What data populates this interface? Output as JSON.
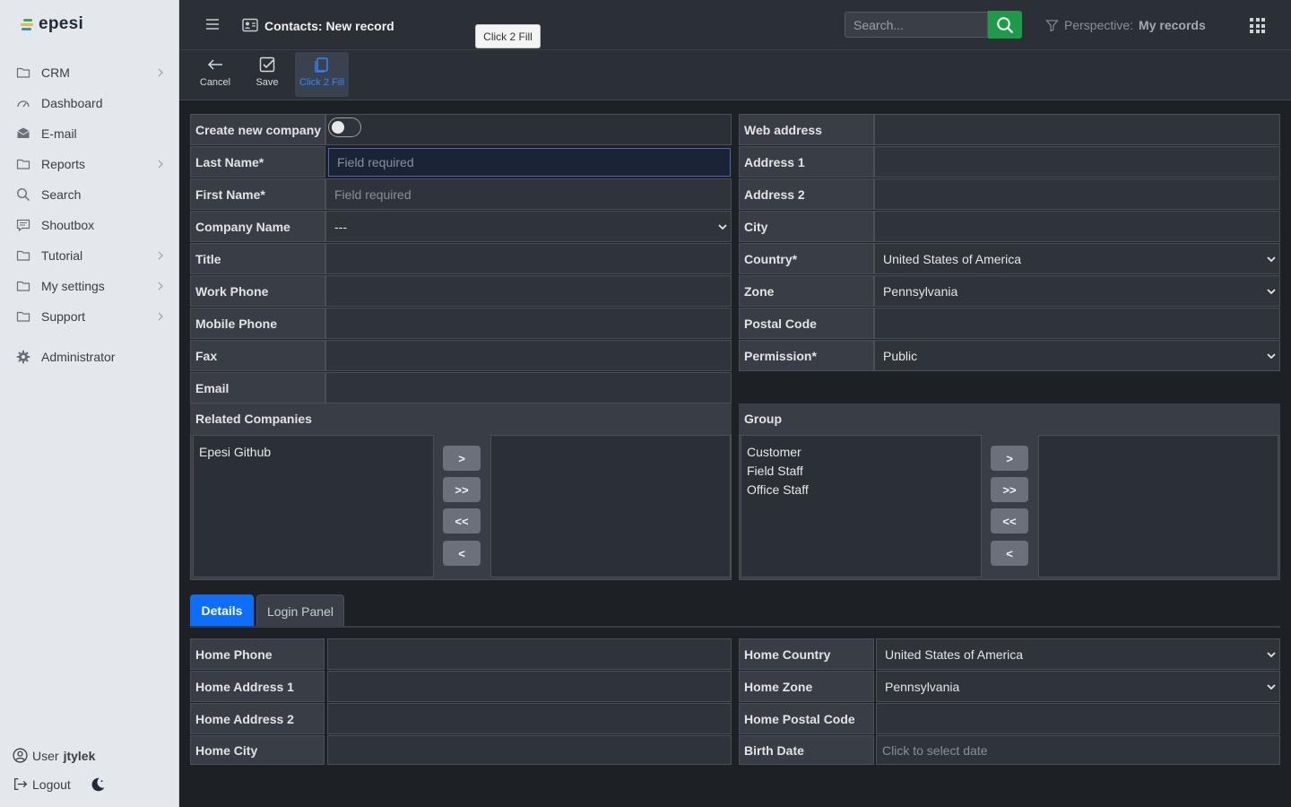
{
  "app": {
    "name": "epesi"
  },
  "sidebar": {
    "items": [
      {
        "label": "CRM",
        "icon": "folder-icon",
        "submenu": true
      },
      {
        "label": "Dashboard",
        "icon": "dashboard-icon",
        "submenu": false
      },
      {
        "label": "E-mail",
        "icon": "envelope-icon",
        "submenu": false
      },
      {
        "label": "Reports",
        "icon": "folder-icon",
        "submenu": true
      },
      {
        "label": "Search",
        "icon": "search-icon",
        "submenu": false
      },
      {
        "label": "Shoutbox",
        "icon": "chat-icon",
        "submenu": false
      },
      {
        "label": "Tutorial",
        "icon": "folder-icon",
        "submenu": true
      },
      {
        "label": "My settings",
        "icon": "folder-icon",
        "submenu": true
      },
      {
        "label": "Support",
        "icon": "folder-icon",
        "submenu": true
      },
      {
        "label": "Administrator",
        "icon": "gear-icon",
        "submenu": false
      }
    ],
    "user_label": "User",
    "username": "jtylek",
    "logout_label": "Logout"
  },
  "header": {
    "title": "Contacts: New record",
    "tooltip": "Click 2 Fill",
    "search_placeholder": "Search...",
    "perspective_label": "Perspective:",
    "perspective_value": "My records"
  },
  "toolbar": {
    "cancel_label": "Cancel",
    "save_label": "Save",
    "click2fill_label": "Click 2 Fill"
  },
  "form": {
    "create_company_label": "Create new company",
    "create_company_on": false,
    "left_fields": [
      {
        "label": "Last Name*",
        "value": "",
        "placeholder": "Field required"
      },
      {
        "label": "First Name*",
        "value": "",
        "placeholder": "Field required"
      },
      {
        "label": "Company Name",
        "value": "---",
        "placeholder": ""
      },
      {
        "label": "Title",
        "value": "",
        "placeholder": ""
      },
      {
        "label": "Work Phone",
        "value": "",
        "placeholder": ""
      },
      {
        "label": "Mobile Phone",
        "value": "",
        "placeholder": ""
      },
      {
        "label": "Fax",
        "value": "",
        "placeholder": ""
      },
      {
        "label": "Email",
        "value": "",
        "placeholder": ""
      }
    ],
    "right_fields": [
      {
        "label": "Web address",
        "value": ""
      },
      {
        "label": "Address 1",
        "value": ""
      },
      {
        "label": "Address 2",
        "value": ""
      },
      {
        "label": "City",
        "value": ""
      },
      {
        "label": "Country*",
        "value": "United States of America"
      },
      {
        "label": "Zone",
        "value": "Pennsylvania"
      },
      {
        "label": "Postal Code",
        "value": ""
      },
      {
        "label": "Permission*",
        "value": "Public"
      }
    ],
    "related_companies": {
      "label": "Related Companies",
      "available": [
        "Epesi Github"
      ],
      "selected": []
    },
    "group": {
      "label": "Group",
      "available": [
        "Customer",
        "Field Staff",
        "Office Staff"
      ],
      "selected": []
    },
    "move_buttons": [
      ">",
      ">>",
      "<<",
      "<"
    ]
  },
  "tabs": [
    {
      "label": "Details",
      "active": true
    },
    {
      "label": "Login Panel",
      "active": false
    }
  ],
  "details": {
    "left_fields": [
      {
        "label": "Home Phone",
        "value": ""
      },
      {
        "label": "Home Address 1",
        "value": ""
      },
      {
        "label": "Home Address 2",
        "value": ""
      },
      {
        "label": "Home City",
        "value": ""
      }
    ],
    "right_fields": [
      {
        "label": "Home Country",
        "value": "United States of America",
        "placeholder": ""
      },
      {
        "label": "Home Zone",
        "value": "Pennsylvania",
        "placeholder": ""
      },
      {
        "label": "Home Postal Code",
        "value": "",
        "placeholder": ""
      },
      {
        "label": "Birth Date",
        "value": "",
        "placeholder": "Click to select date"
      }
    ]
  },
  "colors": {
    "accent": "#0d6efd",
    "search_button": "#1e9a4b",
    "sidebar_bg": "#e4e7ec",
    "page_bg": "#1d2025"
  }
}
